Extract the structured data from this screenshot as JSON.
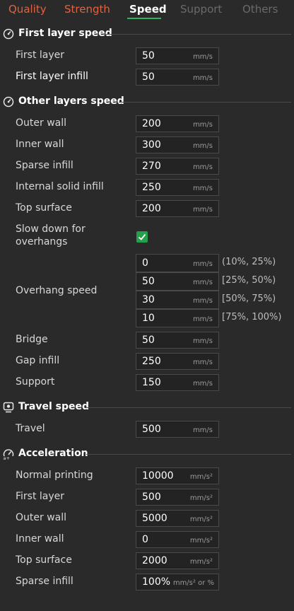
{
  "tabs": [
    {
      "label": "Quality",
      "state": "orange"
    },
    {
      "label": "Strength",
      "state": "orange"
    },
    {
      "label": "Speed",
      "state": "active"
    },
    {
      "label": "Support",
      "state": "dim"
    },
    {
      "label": "Others",
      "state": "dim"
    }
  ],
  "sections": {
    "first_layer_speed": {
      "title": "First layer speed",
      "icon": "speedometer-icon"
    },
    "other_layers_speed": {
      "title": "Other layers speed",
      "icon": "speedometer-icon"
    },
    "travel_speed": {
      "title": "Travel speed",
      "icon": "travel-icon"
    },
    "acceleration": {
      "title": "Acceleration",
      "icon": "acceleration-icon"
    }
  },
  "first_layer": {
    "first_layer": {
      "label": "First layer",
      "value": "50",
      "unit": "mm/s"
    },
    "first_layer_infill": {
      "label": "First layer infill",
      "value": "50",
      "unit": "mm/s"
    }
  },
  "other_layers": {
    "outer_wall": {
      "label": "Outer wall",
      "value": "200",
      "unit": "mm/s"
    },
    "inner_wall": {
      "label": "Inner wall",
      "value": "300",
      "unit": "mm/s"
    },
    "sparse_infill": {
      "label": "Sparse infill",
      "value": "270",
      "unit": "mm/s"
    },
    "internal_solid_infill": {
      "label": "Internal solid infill",
      "value": "250",
      "unit": "mm/s"
    },
    "top_surface": {
      "label": "Top surface",
      "value": "200",
      "unit": "mm/s"
    },
    "slow_down": {
      "label_line1": "Slow down for",
      "label_line2": "overhangs",
      "checked": true
    },
    "overhang": {
      "label": "Overhang speed",
      "rows": [
        {
          "value": "0",
          "unit": "mm/s",
          "range": "(10%, 25%)"
        },
        {
          "value": "50",
          "unit": "mm/s",
          "range": "[25%, 50%)"
        },
        {
          "value": "30",
          "unit": "mm/s",
          "range": "[50%, 75%)"
        },
        {
          "value": "10",
          "unit": "mm/s",
          "range": "[75%, 100%)"
        }
      ]
    },
    "bridge": {
      "label": "Bridge",
      "value": "50",
      "unit": "mm/s"
    },
    "gap_infill": {
      "label": "Gap infill",
      "value": "250",
      "unit": "mm/s"
    },
    "support": {
      "label": "Support",
      "value": "150",
      "unit": "mm/s"
    }
  },
  "travel": {
    "travel": {
      "label": "Travel",
      "value": "500",
      "unit": "mm/s"
    }
  },
  "acceleration": {
    "normal_printing": {
      "label": "Normal printing",
      "value": "10000",
      "unit": "mm/s²"
    },
    "first_layer": {
      "label": "First layer",
      "value": "500",
      "unit": "mm/s²"
    },
    "outer_wall": {
      "label": "Outer wall",
      "value": "5000",
      "unit": "mm/s²"
    },
    "inner_wall": {
      "label": "Inner wall",
      "value": "0",
      "unit": "mm/s²"
    },
    "top_surface": {
      "label": "Top surface",
      "value": "2000",
      "unit": "mm/s²"
    },
    "sparse_infill": {
      "label": "Sparse infill",
      "value": "100%",
      "unit": "mm/s² or %"
    }
  },
  "colors": {
    "accent": "#2fb35d",
    "tab_orange": "#e0623e",
    "checkbox": "#23a04a"
  }
}
